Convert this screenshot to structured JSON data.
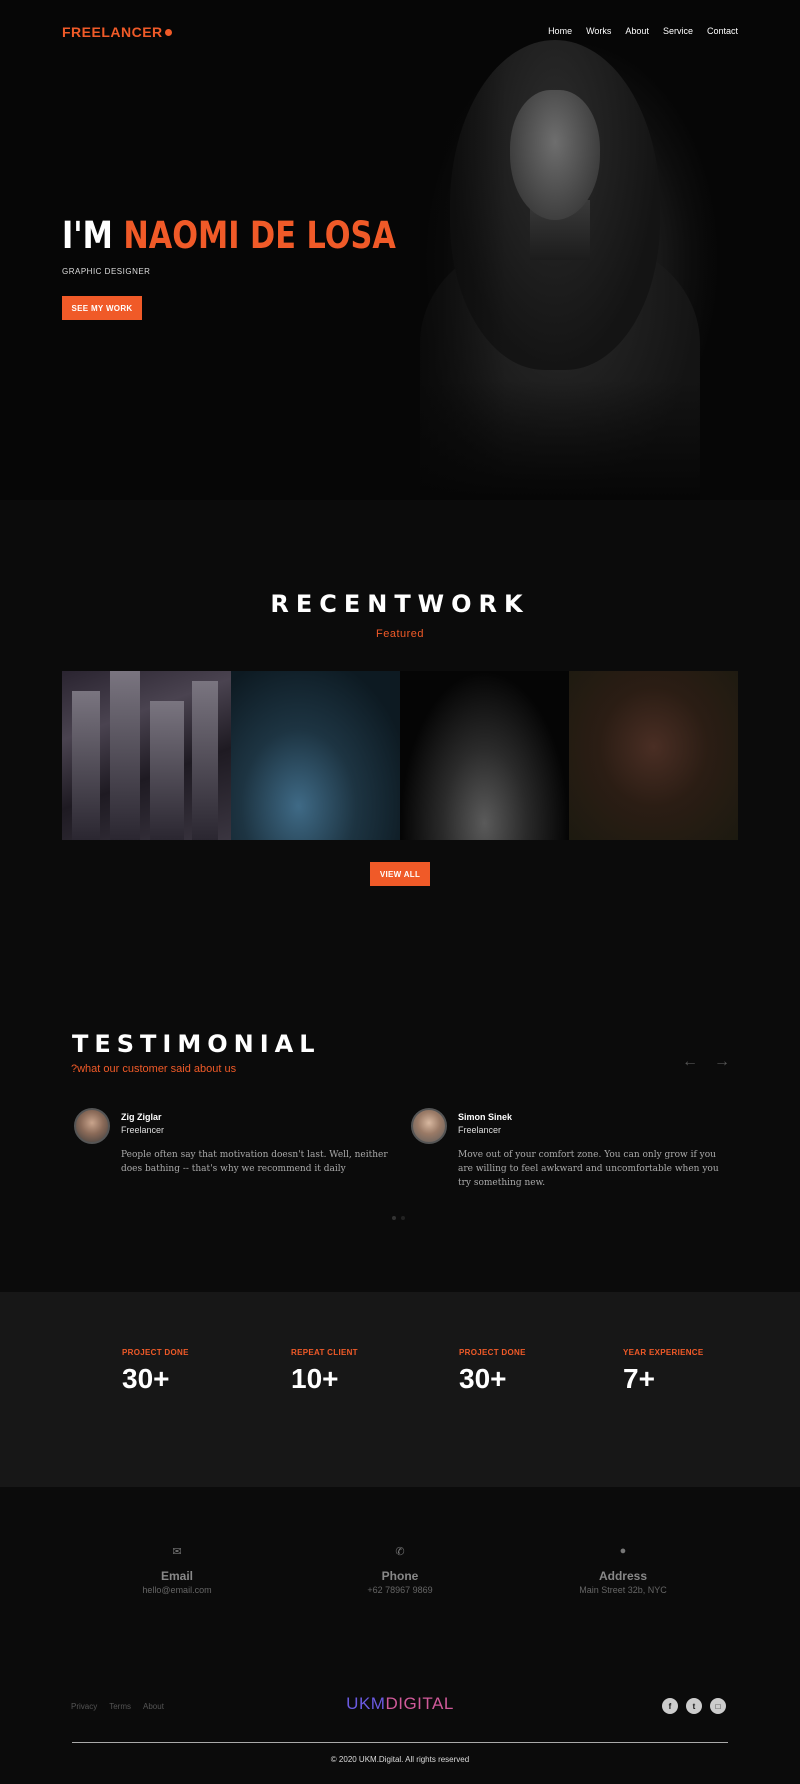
{
  "nav": {
    "logo": "FREELANCER",
    "items": [
      "Home",
      "Works",
      "About",
      "Service",
      "Contact"
    ]
  },
  "hero": {
    "title_prefix": "I'M ",
    "title_name": "NAOMI DE LOSA",
    "subtitle": "GRAPHIC DESIGNER",
    "cta": "SEE MY WORK"
  },
  "recent": {
    "title": "RECENTWORK",
    "subtitle": "Featured",
    "cta": "VIEW ALL"
  },
  "testimonial": {
    "title": "TESTIMONIAL",
    "subtitle": "?what our customer said about us",
    "items": [
      {
        "name": "Zig Ziglar",
        "role": "Freelancer",
        "text": "People often say that motivation doesn't last. Well, neither does bathing -- that's why we recommend it daily"
      },
      {
        "name": "Simon Sinek",
        "role": "Freelancer",
        "text": "Move out of your comfort zone. You can only grow if you are willing to feel awkward and uncomfortable when you try something new."
      }
    ]
  },
  "stats": [
    {
      "label": "PROJECT DONE",
      "value": "30+"
    },
    {
      "label": "REPEAT CLIENT",
      "value": "10+"
    },
    {
      "label": "PROJECT DONE",
      "value": "30+"
    },
    {
      "label": "YEAR EXPERIENCE",
      "value": "7+"
    }
  ],
  "contact": [
    {
      "icon": "email-icon",
      "title": "Email",
      "value": "hello@email.com"
    },
    {
      "icon": "phone-icon",
      "title": "Phone",
      "value": "+62 78967 9869"
    },
    {
      "icon": "location-pin-icon",
      "title": "Address",
      "value": "Main Street 32b, NYC"
    }
  ],
  "footer": {
    "links": [
      "Privacy",
      "Terms",
      "About"
    ],
    "brand_a": "UKM",
    "brand_b": "DIGITAL",
    "copyright": "© 2020 UKM.Digital. All rights reserved",
    "socials": [
      "facebook-icon",
      "twitter-icon",
      "instagram-icon"
    ]
  },
  "colors": {
    "accent": "#f05a28",
    "background": "#0b0b0b",
    "stats_band": "#171717"
  }
}
